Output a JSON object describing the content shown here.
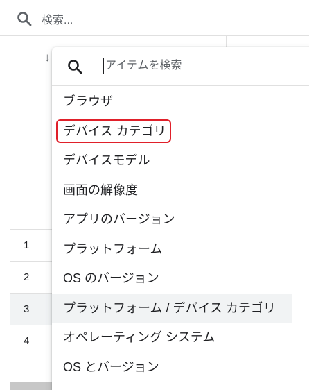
{
  "top_search": {
    "placeholder": "検索...",
    "icon": "search-icon"
  },
  "table": {
    "sort_icon": "arrow-down-icon",
    "rows": [
      {
        "index": "1"
      },
      {
        "index": "2"
      },
      {
        "index": "3"
      },
      {
        "index": "4"
      }
    ]
  },
  "dropdown": {
    "search_placeholder": "アイテムを検索",
    "search_icon": "search-icon",
    "items": [
      {
        "label": "ブラウザ"
      },
      {
        "label": "デバイス カテゴリ"
      },
      {
        "label": "デバイスモデル"
      },
      {
        "label": "画面の解像度"
      },
      {
        "label": "アプリのバージョン"
      },
      {
        "label": "プラットフォーム"
      },
      {
        "label": "OS のバージョン"
      },
      {
        "label": "プラットフォーム / デバイス カテゴリ"
      },
      {
        "label": "オペレーティング システム"
      },
      {
        "label": "OS とバージョン"
      }
    ],
    "highlighted_color": "#e0202a"
  }
}
